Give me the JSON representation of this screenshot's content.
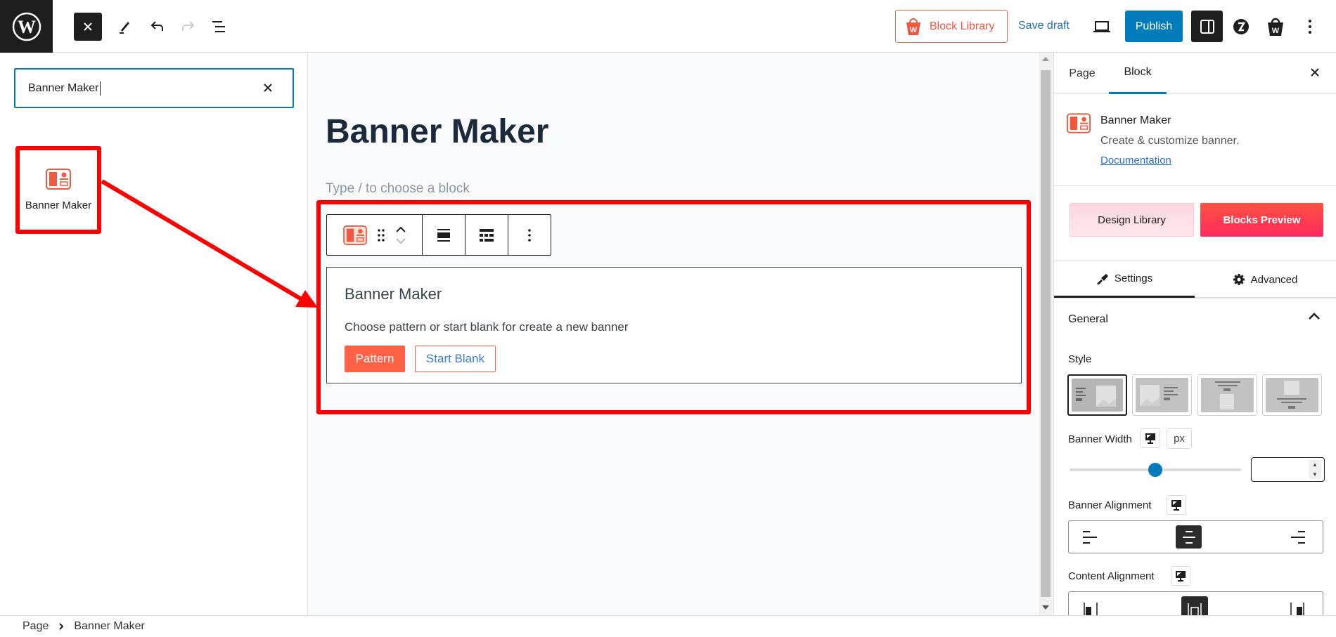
{
  "topbar": {
    "block_library_label": "Block Library",
    "save_draft_label": "Save draft",
    "publish_label": "Publish",
    "icons": [
      "wordpress-logo",
      "close-icon",
      "pen-tool-icon",
      "undo-icon",
      "redo-icon",
      "document-overview-icon",
      "block-library-bag-icon",
      "preview-desktop-icon",
      "settings-sidebar-icon",
      "plugin-z-icon",
      "plugin-bag-icon",
      "more-options-icon"
    ]
  },
  "inserter": {
    "search_value": "Banner Maker",
    "results": [
      {
        "label": "Banner Maker",
        "icon": "banner-maker-icon"
      }
    ]
  },
  "canvas": {
    "page_title": "Banner Maker",
    "placeholder": "Type / to choose a block",
    "block": {
      "heading": "Banner Maker",
      "description": "Choose pattern or start blank for create a new banner",
      "pattern_label": "Pattern",
      "start_blank_label": "Start Blank"
    }
  },
  "sidebar": {
    "tabs": [
      {
        "label": "Page",
        "active": false
      },
      {
        "label": "Block",
        "active": true
      }
    ],
    "block_info": {
      "title": "Banner Maker",
      "description": "Create & customize banner.",
      "doc_link": "Documentation"
    },
    "design_library_label": "Design Library",
    "blocks_preview_label": "Blocks Preview",
    "settings_tabs": [
      {
        "label": "Settings",
        "active": true
      },
      {
        "label": "Advanced",
        "active": false
      }
    ],
    "panel_title": "General",
    "style_label": "Style",
    "style_selected_index": 0,
    "banner_width_label": "Banner Width",
    "banner_width_unit": "px",
    "banner_width_slider_fraction": 0.5,
    "banner_width_value": "",
    "banner_alignment_label": "Banner Alignment",
    "banner_alignment_selected": "center",
    "content_alignment_label": "Content Alignment",
    "content_alignment_selected": "center"
  },
  "footer": {
    "breadcrumb": [
      "Page",
      "Banner Maker"
    ]
  },
  "colors": {
    "accent": "#007cba",
    "brand_orange": "#ff6247",
    "annotation_red": "#ff0000"
  }
}
